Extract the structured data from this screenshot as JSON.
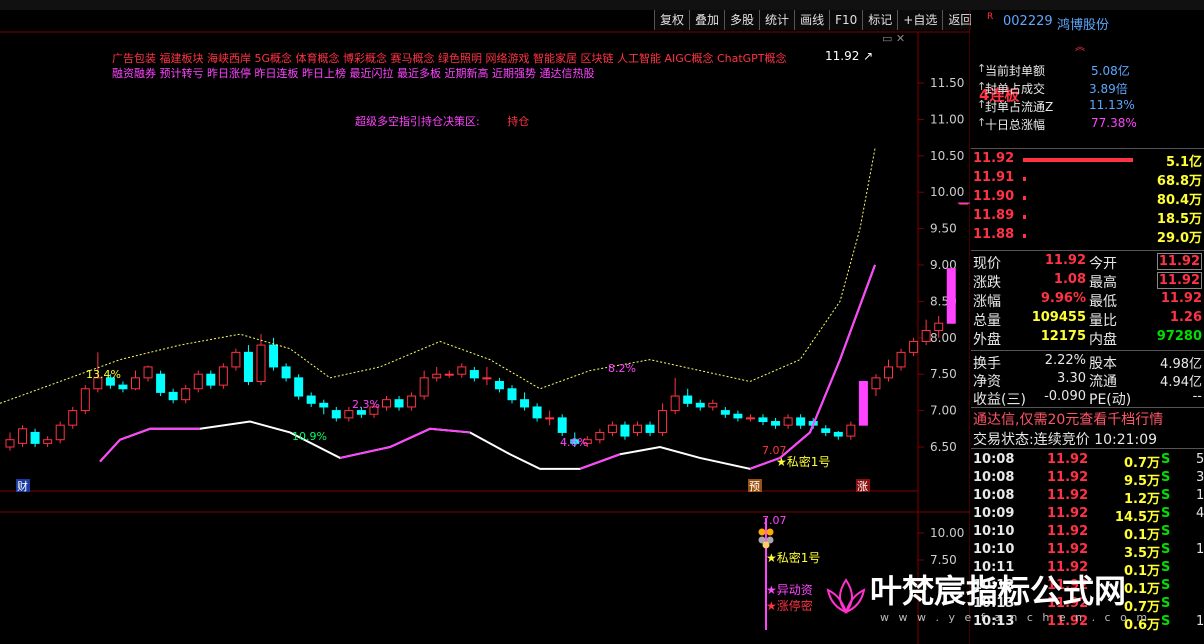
{
  "toolbar": [
    "复权",
    "叠加",
    "多股",
    "统计",
    "画线",
    "F10",
    "标记",
    "+自选",
    "返回"
  ],
  "concepts_line1": "广告包装   福建板块   海峡西岸 5G概念 体育概念 博彩概念 赛马概念 绿色照明 网络游戏 智能家居 区块链 人工智能 AIGC概念 ChatGPT概念",
  "concepts_line2": "融资融券 预计转亏 昨日涨停 昨日连板 昨日上榜 最近闪拉 最近多板 近期新高 近期强势 通达信热股",
  "strategy": {
    "label": "超级多空指引持仓决策区:",
    "value": "持仓"
  },
  "price_label": "11.92",
  "markers": {
    "cai": "财",
    "yu": "预",
    "zhang": "涨",
    "pct": [
      "13.4%",
      "10.9%",
      "2.3%",
      "4.6%",
      "8.2%"
    ],
    "low": "7.07",
    "secret": "★私密1号",
    "yidong": "★异动资",
    "zhangting": "★涨停密"
  },
  "axis_top": [
    "11.50",
    "11.00",
    "10.50",
    "10.00",
    "9.50",
    "9.00",
    "8.50",
    "8.00",
    "7.50",
    "7.00",
    "6.50"
  ],
  "axis_bottom": [
    "10.00",
    "7.50"
  ],
  "stock": {
    "code": "002229",
    "name": "鸿博股份",
    "badge": "4连板"
  },
  "seal": [
    {
      "label": "当前封单额",
      "value": "5.08亿"
    },
    {
      "label": "封单占成交",
      "value": "3.89倍"
    },
    {
      "label": "封单占流通Z",
      "value": "11.13%"
    },
    {
      "label": "十日总涨幅",
      "value": "77.38%"
    }
  ],
  "bids": [
    {
      "price": "11.92",
      "vol": "5.1亿",
      "bar": 1.0
    },
    {
      "price": "11.91",
      "vol": "68.8万",
      "bar": 0.02
    },
    {
      "price": "11.90",
      "vol": "80.4万",
      "bar": 0.02
    },
    {
      "price": "11.89",
      "vol": "18.5万",
      "bar": 0.02
    },
    {
      "price": "11.88",
      "vol": "29.0万",
      "bar": 0.02
    }
  ],
  "quote": [
    {
      "l1": "现价",
      "v1": "11.92",
      "l2": "今开",
      "v2": "11.92"
    },
    {
      "l1": "涨跌",
      "v1": "1.08",
      "l2": "最高",
      "v2": "11.92"
    },
    {
      "l1": "涨幅",
      "v1": "9.96%",
      "l2": "最低",
      "v2": "11.92"
    },
    {
      "l1": "总量",
      "v1": "109455",
      "l2": "量比",
      "v2": "1.26"
    },
    {
      "l1": "外盘",
      "v1": "12175",
      "l2": "内盘",
      "v2": "97280"
    }
  ],
  "fund": [
    {
      "l1": "换手",
      "v1": "2.22%",
      "l2": "股本",
      "v2": "4.98亿"
    },
    {
      "l1": "净资",
      "v1": "3.30",
      "l2": "流通",
      "v2": "4.94亿"
    },
    {
      "l1": "收益(三)",
      "v1": "-0.090",
      "l2": "PE(动)",
      "v2": "--"
    }
  ],
  "notice": "通达信,仅需20元查看千档行情",
  "trade_status": "交易状态:连续竞价 10:21:09",
  "ticks": [
    {
      "t": "10:08",
      "p": "11.92",
      "v": "0.7万",
      "s": "S",
      "n": "5"
    },
    {
      "t": "10:08",
      "p": "11.92",
      "v": "9.5万",
      "s": "S",
      "n": "3"
    },
    {
      "t": "10:08",
      "p": "11.92",
      "v": "1.2万",
      "s": "S",
      "n": "1"
    },
    {
      "t": "10:09",
      "p": "11.92",
      "v": "14.5万",
      "s": "S",
      "n": "4"
    },
    {
      "t": "10:10",
      "p": "11.92",
      "v": "0.1万",
      "s": "S",
      "n": ""
    },
    {
      "t": "10:10",
      "p": "11.92",
      "v": "3.5万",
      "s": "S",
      "n": "1"
    },
    {
      "t": "10:11",
      "p": "11.92",
      "v": "0.1万",
      "s": "S",
      "n": ""
    },
    {
      "t": "10:12",
      "p": "11.92",
      "v": "0.1万",
      "s": "S",
      "n": ""
    },
    {
      "t": "10:13",
      "p": "11.92",
      "v": "0.7万",
      "s": "S",
      "n": ""
    },
    {
      "t": "10:13",
      "p": "11.92",
      "v": "0.6万",
      "s": "S",
      "n": "1"
    }
  ],
  "watermark": "叶梵宸指标公式网",
  "watermark_url": "w w w . y e f a n c h e n . c o m",
  "colors": {
    "up": "#ff3344",
    "down": "#00ffff",
    "magenta": "#ff44ff",
    "yellow": "#ffff33"
  }
}
